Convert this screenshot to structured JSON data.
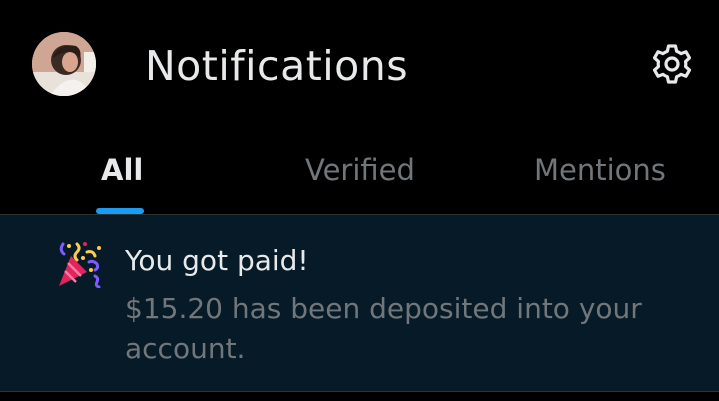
{
  "header": {
    "title": "Notifications",
    "avatar_icon": "user-avatar",
    "settings_icon": "gear-icon"
  },
  "tabs": [
    {
      "label": "All",
      "active": true
    },
    {
      "label": "Verified",
      "active": false
    },
    {
      "label": "Mentions",
      "active": false
    }
  ],
  "notifications": [
    {
      "icon": "party-popper-icon",
      "title": "You got paid!",
      "body": "$15.20 has been deposited into your account."
    }
  ],
  "colors": {
    "background": "#000000",
    "primary_text": "#e7e9ea",
    "secondary_text": "#71767b",
    "accent": "#1d9bf0",
    "notification_bg": "#061a27",
    "divider": "#2f3336"
  }
}
